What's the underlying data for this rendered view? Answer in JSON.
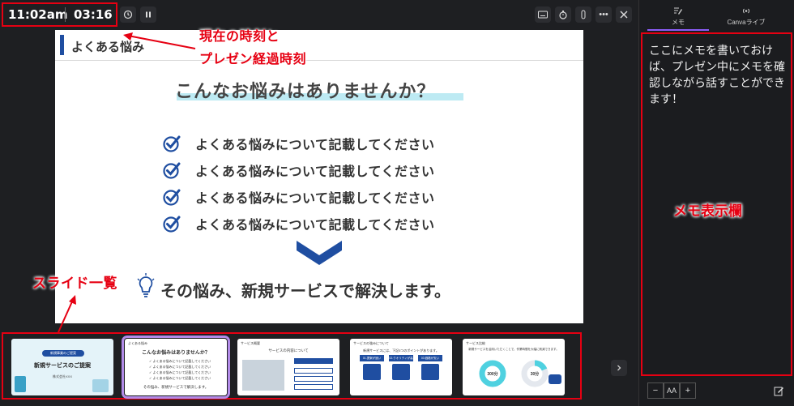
{
  "topbar": {
    "current_time": "11:02am",
    "elapsed_time": "03:16"
  },
  "slide": {
    "header": "よくある悩み",
    "title": "こんなお悩みはありませんか？",
    "checks": [
      "よくある悩みについて記載してください",
      "よくある悩みについて記載してください",
      "よくある悩みについて記載してください",
      "よくある悩みについて記載してください"
    ],
    "footer": "その悩み、新規サービスで解決します。"
  },
  "annotations": {
    "time_label_line1": "現在の時刻と",
    "time_label_line2": "プレゼン経過時刻",
    "slides_label": "スライド一覧",
    "memo_label": "メモ表示欄"
  },
  "thumbnails": [
    {
      "title": "新規サービスのご提案",
      "badge": "新規事業のご提案",
      "sub": "株式会社XXX"
    },
    {
      "title": "こんなお悩みはありませんか？",
      "head": "よくある悩み",
      "foot": "その悩み、新規サービスで解決します。"
    },
    {
      "head": "サービス概要",
      "title": "サービスの内容について"
    },
    {
      "head": "サービスの強みについて",
      "title": "新規サービスには、下記3つのポイントがあります。",
      "cards": [
        "01.提案が速い",
        "02.クオリティが高い",
        "03.価格が安い"
      ]
    },
    {
      "head": "サービス比較",
      "title": "新規サービスを活用いただくことで、作業時間を大幅に削減できます。",
      "v1": "300分",
      "v2": "30分"
    }
  ],
  "sidebar": {
    "tab_memo": "メモ",
    "tab_live": "Canvaライブ",
    "memo_text": "ここにメモを書いておけば、プレゼン中にメモを確認しながら話すことができます！",
    "zoom_minus": "−",
    "zoom_label": "AA",
    "zoom_plus": "+"
  },
  "colors": {
    "accent_red": "#e60012",
    "brand_blue": "#1f4ea1",
    "tab_purple": "#8b5cf6"
  }
}
